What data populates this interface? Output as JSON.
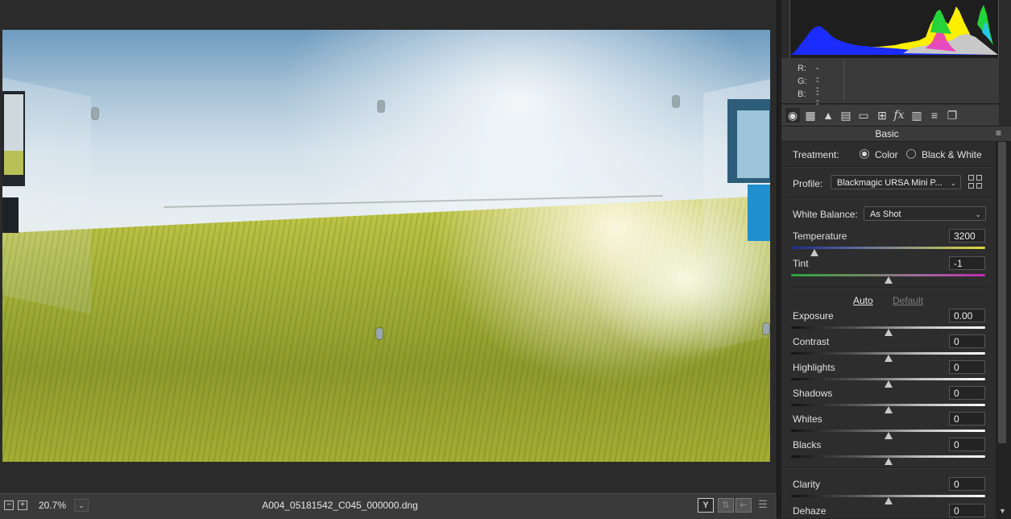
{
  "status_bar": {
    "zoom_out": "−",
    "zoom_in": "+",
    "zoom_level": "20.7%",
    "zoom_chevron": "⌄",
    "filename": "A004_05181542_C045_000000.dng",
    "y_button": "Y",
    "icon_swap": "⇅",
    "icon_copy": "⇤",
    "icon_prefs": "☰"
  },
  "rgb_readout": {
    "r_label": "R:",
    "r_value": "---",
    "g_label": "G:",
    "g_value": "---",
    "b_label": "B:",
    "b_value": "---"
  },
  "tabs": {
    "icons": [
      "aperture-icon",
      "tone-curve-grid-icon",
      "detail-triangle-icon",
      "hsl-icon",
      "split-toning-icon",
      "lens-corrections-icon",
      "fx-icon",
      "calibration-film-icon",
      "presets-icon",
      "snapshots-icon"
    ],
    "glyphs": [
      "◉",
      "▦",
      "▲",
      "▤",
      "▭",
      "⊞",
      "fx",
      "▥",
      "≡",
      "❐"
    ]
  },
  "panel": {
    "title": "Basic",
    "menu_glyph": "≡"
  },
  "basic": {
    "treatment_label": "Treatment:",
    "treatment_color": "Color",
    "treatment_bw": "Black & White",
    "treatment_selected": "Color",
    "profile_label": "Profile:",
    "profile_value": "Blackmagic URSA Mini P...",
    "white_balance_label": "White Balance:",
    "white_balance_value": "As Shot",
    "auto": "Auto",
    "default": "Default",
    "sliders": [
      {
        "label": "Temperature",
        "value": "3200",
        "level": 0.12
      },
      {
        "label": "Tint",
        "value": "-1",
        "level": 0.5
      },
      {
        "label": "Exposure",
        "value": "0.00",
        "level": 0.5
      },
      {
        "label": "Contrast",
        "value": "0",
        "level": 0.5
      },
      {
        "label": "Highlights",
        "value": "0",
        "level": 0.5
      },
      {
        "label": "Shadows",
        "value": "0",
        "level": 0.5
      },
      {
        "label": "Whites",
        "value": "0",
        "level": 0.5
      },
      {
        "label": "Blacks",
        "value": "0",
        "level": 0.5
      },
      {
        "label": "Clarity",
        "value": "0",
        "level": 0.5
      },
      {
        "label": "Dehaze",
        "value": "0",
        "level": 0.5
      }
    ]
  }
}
